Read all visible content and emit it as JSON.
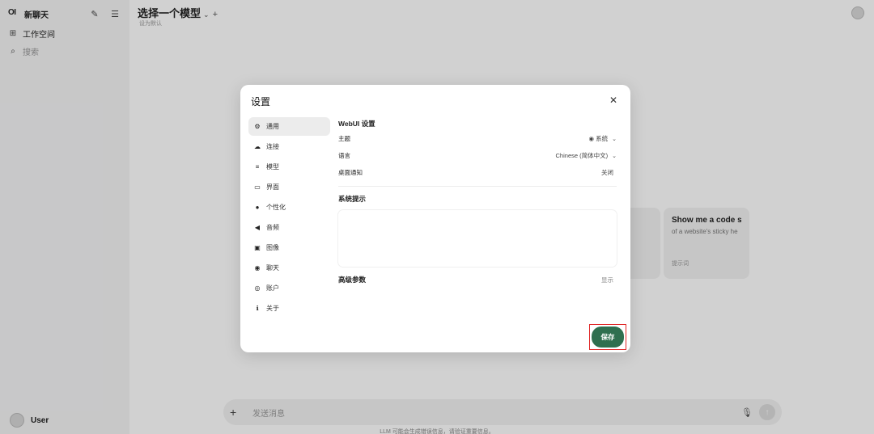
{
  "sidebar": {
    "logo": "OI",
    "new_chat": "新聊天",
    "workspace": "工作空间",
    "search_placeholder": "搜索",
    "user": "User"
  },
  "main": {
    "model_selector": "选择一个模型",
    "set_default": "设为默认",
    "suggestions": [
      {
        "title": "",
        "subtitle": "",
        "footer": ""
      },
      {
        "title": "Show me a code sn",
        "subtitle": "of a website's sticky he",
        "footer": "提示词"
      }
    ],
    "composer_placeholder": "发送消息",
    "disclaimer": "LLM 可能会生成错误信息，请验证重要信息。"
  },
  "settings": {
    "title": "设置",
    "nav": [
      {
        "label": "通用",
        "icon": "gear-icon",
        "active": true
      },
      {
        "label": "连接",
        "icon": "cloud-icon",
        "active": false
      },
      {
        "label": "模型",
        "icon": "database-icon",
        "active": false
      },
      {
        "label": "界面",
        "icon": "monitor-icon",
        "active": false
      },
      {
        "label": "个性化",
        "icon": "person-icon",
        "active": false
      },
      {
        "label": "音频",
        "icon": "speaker-icon",
        "active": false
      },
      {
        "label": "图像",
        "icon": "image-icon",
        "active": false
      },
      {
        "label": "聊天",
        "icon": "chat-bubble-icon",
        "active": false
      },
      {
        "label": "账户",
        "icon": "user-circle-icon",
        "active": false
      },
      {
        "label": "关于",
        "icon": "info-icon",
        "active": false
      }
    ],
    "webui_section": "WebUI 设置",
    "theme_label": "主题",
    "theme_value": "系统",
    "language_label": "语言",
    "language_value": "Chinese (简体中文)",
    "notification_label": "桌面通知",
    "notification_value": "关闭",
    "system_prompt_label": "系统提示",
    "system_prompt_value": "",
    "advanced_label": "高级参数",
    "advanced_toggle": "显示",
    "save": "保存"
  },
  "colors": {
    "save_button": "#2f6f4f",
    "highlight_border": "#e02828"
  }
}
